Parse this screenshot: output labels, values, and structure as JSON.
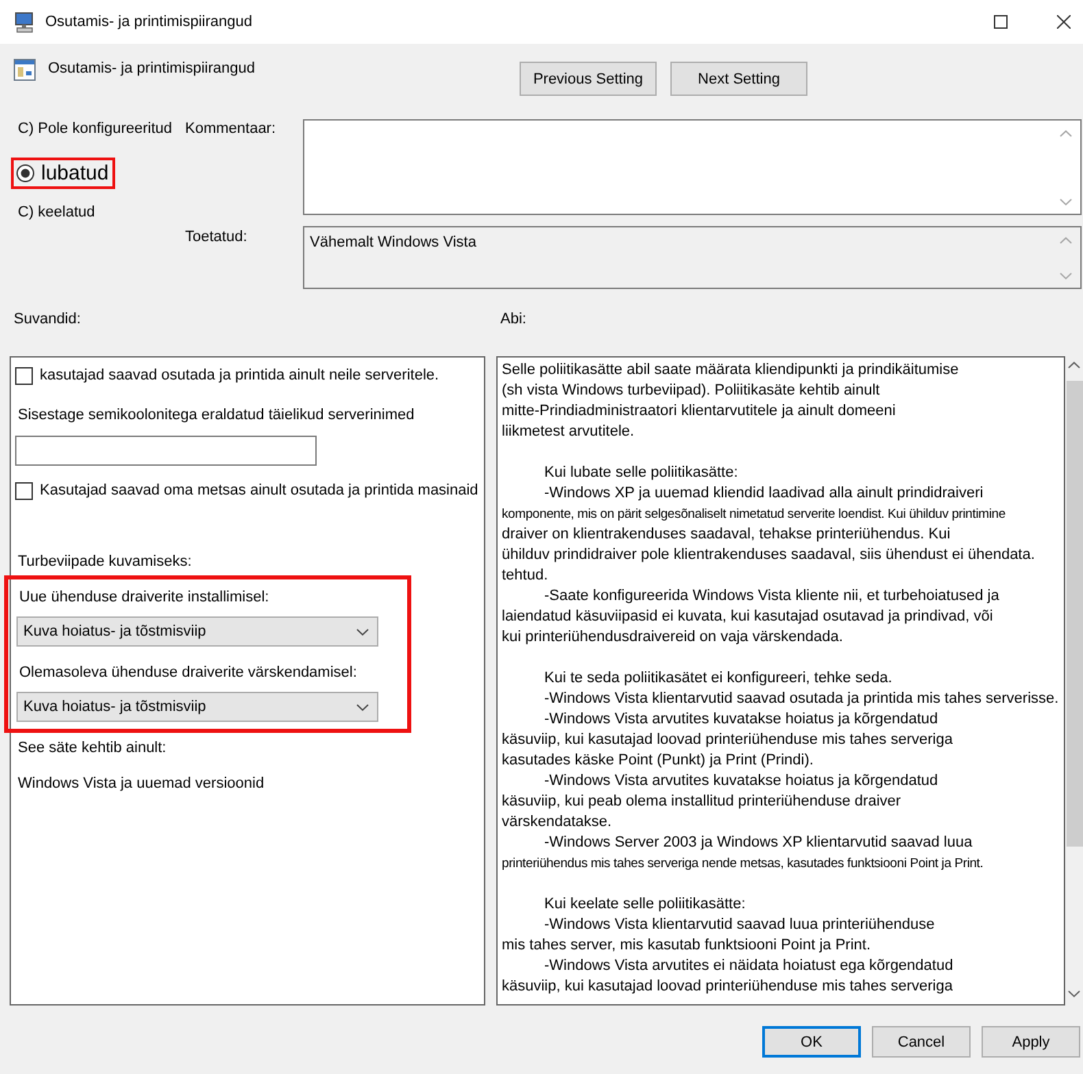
{
  "window": {
    "title": "Osutamis- ja printimispiirangud"
  },
  "header": {
    "title": "Osutamis- ja printimispiirangud",
    "buttons": [
      {
        "label": "Previous Setting"
      },
      {
        "label": "Next Setting"
      }
    ]
  },
  "state": {
    "options": [
      {
        "label": "C) Pole konfigureeritud",
        "selected": false,
        "highlighted": false
      },
      {
        "label": "lubatud",
        "selected": true,
        "highlighted": true
      },
      {
        "label": "C) keelatud",
        "selected": false,
        "highlighted": false
      }
    ]
  },
  "comment": {
    "label": "Kommentaar:"
  },
  "supported": {
    "label": "Toetatud:",
    "value": "Vähemalt Windows Vista"
  },
  "options": {
    "label": "Suvandid:",
    "items": [
      {
        "kind": "checkbox",
        "label": "kasutajad saavad osutada ja printida ainult neile serveritele.",
        "checked": false
      },
      {
        "kind": "text",
        "text": "Sisestage semikoolonitega eraldatud täielikud serverinimed"
      },
      {
        "kind": "input"
      },
      {
        "kind": "checkbox",
        "label": "Kasutajad saavad oma metsas ainult osutada ja printida masinaid",
        "checked": false
      },
      {
        "kind": "heading",
        "text": "Turbeviipade kuvamiseks:"
      },
      {
        "kind": "group",
        "highlighted": true,
        "items": [
          {
            "kind": "dropdown",
            "label": "Uue ühenduse draiverite installimisel:",
            "value": "Kuva hoiatus- ja tõstmisviip"
          },
          {
            "kind": "dropdown",
            "label": "Olemasoleva ühenduse draiverite värskendamisel:",
            "value": "Kuva hoiatus- ja tõstmisviip"
          }
        ]
      },
      {
        "kind": "text",
        "text": "See säte kehtib ainult:"
      },
      {
        "kind": "text",
        "text": "Windows Vista ja uuemad versioonid"
      }
    ]
  },
  "help": {
    "label": "Abi:",
    "sections": [
      {
        "paragraphs": [
          {
            "indented": false,
            "lines": [
              {
                "text": "Selle poliitikasätte abil saate määrata kliendipunkti ja prindikäitumise",
                "small": false
              },
              {
                "text": "(sh vista Windows turbeviipad). Poliitikasäte kehtib ainult",
                "small": false
              },
              {
                "text": "mitte-Prindiadministraatori klientarvutitele ja ainult domeeni",
                "small": false
              },
              {
                "text": "liikmetest arvutitele.",
                "small": false
              }
            ]
          }
        ]
      },
      {
        "paragraphs": [
          {
            "indented": true,
            "lines": [
              {
                "text": "Kui lubate selle poliitikasätte:",
                "small": false
              }
            ]
          },
          {
            "indented": true,
            "lines": [
              {
                "text": "-Windows XP ja uuemad kliendid laadivad alla ainult prindidraiveri",
                "small": false
              },
              {
                "text": "komponente, mis on pärit selgesõnaliselt nimetatud serverite loendist. Kui ühilduv printimine",
                "small": true
              },
              {
                "text": "draiver on klientrakenduses saadaval, tehakse printeriühendus. Kui",
                "small": false
              },
              {
                "text": "ühilduv prindidraiver pole klientrakenduses saadaval, siis ühendust ei ühendata.",
                "small": false
              },
              {
                "text": "tehtud.",
                "small": false
              }
            ]
          },
          {
            "indented": true,
            "lines": [
              {
                "text": "-Saate konfigureerida Windows Vista kliente nii, et turbehoiatused ja",
                "small": false
              },
              {
                "text": "laiendatud käsuviipasid ei kuvata, kui kasutajad osutavad ja prindivad, või",
                "small": false
              },
              {
                "text": "kui printeriühendusdraivereid on vaja värskendada.",
                "small": false
              }
            ]
          }
        ]
      },
      {
        "paragraphs": [
          {
            "indented": true,
            "lines": [
              {
                "text": "Kui te seda poliitikasätet ei konfigureeri, tehke seda.",
                "small": false
              }
            ]
          },
          {
            "indented": true,
            "lines": [
              {
                "text": "-Windows Vista klientarvutid saavad osutada ja printida mis tahes serverisse.",
                "small": false
              }
            ]
          },
          {
            "indented": true,
            "lines": [
              {
                "text": "-Windows Vista arvutites kuvatakse hoiatus ja kõrgendatud",
                "small": false
              },
              {
                "text": "käsuviip, kui kasutajad loovad printeriühenduse mis tahes serveriga",
                "small": false
              },
              {
                "text": "kasutades käske Point (Punkt) ja Print (Prindi).",
                "small": false
              }
            ]
          },
          {
            "indented": true,
            "lines": [
              {
                "text": "-Windows Vista arvutites kuvatakse hoiatus ja kõrgendatud",
                "small": false
              },
              {
                "text": "käsuviip, kui peab olema installitud printeriühenduse draiver",
                "small": false
              },
              {
                "text": "värskendatakse.",
                "small": false
              }
            ]
          },
          {
            "indented": true,
            "lines": [
              {
                "text": "-Windows Server 2003 ja Windows XP klientarvutid saavad luua",
                "small": false
              },
              {
                "text": "printeriühendus mis tahes serveriga nende metsas, kasutades funktsiooni Point ja Print.",
                "small": true
              }
            ]
          }
        ]
      },
      {
        "paragraphs": [
          {
            "indented": true,
            "lines": [
              {
                "text": "Kui keelate selle poliitikasätte:",
                "small": false
              }
            ]
          },
          {
            "indented": true,
            "lines": [
              {
                "text": "-Windows Vista klientarvutid saavad luua printeriühenduse",
                "small": false
              },
              {
                "text": "mis tahes server, mis kasutab funktsiooni Point ja Print.",
                "small": false
              }
            ]
          },
          {
            "indented": true,
            "lines": [
              {
                "text": "-Windows Vista arvutites ei näidata hoiatust ega kõrgendatud",
                "small": false
              },
              {
                "text": "käsuviip, kui kasutajad loovad printeriühenduse mis tahes serveriga",
                "small": false
              }
            ]
          }
        ]
      }
    ]
  },
  "buttons": [
    {
      "label": "OK",
      "default": true
    },
    {
      "label": "Cancel",
      "default": false
    },
    {
      "label": "Apply",
      "default": false
    }
  ]
}
